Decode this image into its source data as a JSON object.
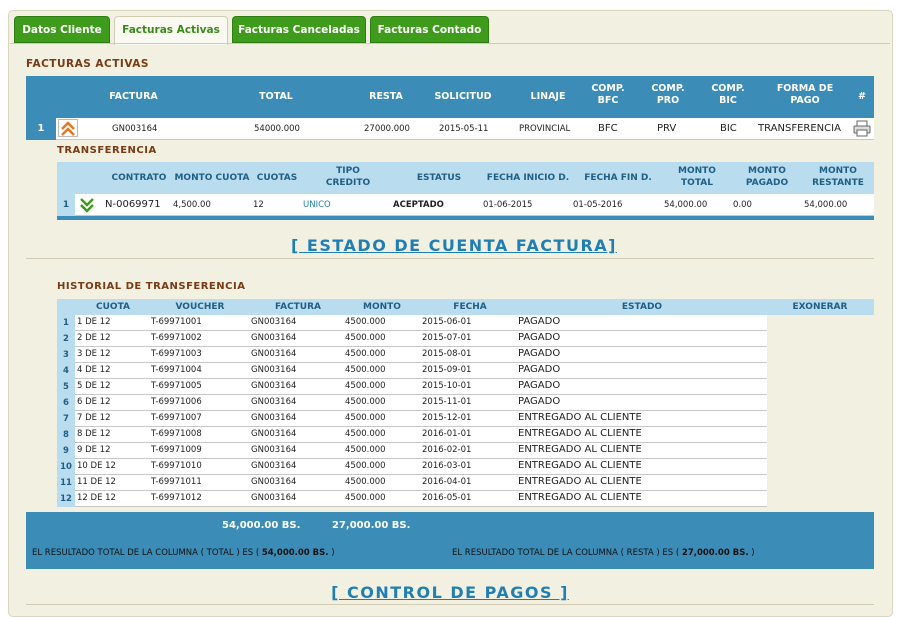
{
  "tabs": [
    {
      "label": "Datos Cliente",
      "active": false
    },
    {
      "label": "Facturas Activas",
      "active": true
    },
    {
      "label": "Facturas Canceladas",
      "active": false
    },
    {
      "label": "Facturas Contado",
      "active": false
    }
  ],
  "facturas": {
    "title": "FACTURAS ACTIVAS",
    "headers": {
      "factura": "FACTURA",
      "total": "TOTAL",
      "resta": "RESTA",
      "solicitud": "SOLICITUD",
      "linaje": "LINAJE",
      "comp_bfc": "COMP. BFC",
      "comp_pro": "COMP. PRO",
      "comp_bic": "COMP. BIC",
      "forma_pago": "FORMA DE PAGO",
      "hash": "#"
    },
    "row": {
      "index": "1",
      "factura": "GN003164",
      "total": "54000.000",
      "resta": "27000.000",
      "solicitud": "2015-05-11",
      "linaje": "PROVINCIAL",
      "comp_bfc": "BFC",
      "comp_pro": "PRV",
      "comp_bic": "BIC",
      "forma_pago": "TRANSFERENCIA",
      "collapse_icon": "double-chevron-up-icon",
      "print_icon": "printer-icon"
    }
  },
  "transferencia": {
    "title": "TRANSFERENCIA",
    "headers": {
      "contrato": "CONTRATO",
      "monto_cuota": "MONTO CUOTA",
      "cuotas": "CUOTAS",
      "tipo_credito": "TIPO CREDITO",
      "estatus": "ESTATUS",
      "fecha_inicio": "FECHA INICIO D.",
      "fecha_fin": "FECHA FIN D.",
      "monto_total": "MONTO TOTAL",
      "monto_pagado": "MONTO PAGADO",
      "monto_restante": "MONTO RESTANTE"
    },
    "row": {
      "index": "1",
      "contrato": "N-0069971",
      "monto_cuota": "4,500.00",
      "cuotas": "12",
      "tipo_credito": "UNICO",
      "estatus": "ACEPTADO",
      "fecha_inicio": "01-06-2015",
      "fecha_fin": "01-05-2016",
      "monto_total": "54,000.00",
      "monto_pagado": "0.00",
      "monto_restante": "54,000.00",
      "expand_icon": "double-chevron-down-icon"
    }
  },
  "estado_link": "[ ESTADO DE CUENTA FACTURA]",
  "historial": {
    "title": "HISTORIAL DE TRANSFERENCIA",
    "headers": {
      "cuota": "CUOTA",
      "voucher": "VOUCHER",
      "factura": "FACTURA",
      "monto": "MONTO",
      "fecha": "FECHA",
      "estado": "ESTADO",
      "exonerar": "EXONERAR"
    },
    "rows": [
      {
        "i": "1",
        "cuota": "1 DE 12",
        "voucher": "T-69971001",
        "factura": "GN003164",
        "monto": "4500.000",
        "fecha": "2015-06-01",
        "estado": "PAGADO"
      },
      {
        "i": "2",
        "cuota": "2 DE 12",
        "voucher": "T-69971002",
        "factura": "GN003164",
        "monto": "4500.000",
        "fecha": "2015-07-01",
        "estado": "PAGADO"
      },
      {
        "i": "3",
        "cuota": "3 DE 12",
        "voucher": "T-69971003",
        "factura": "GN003164",
        "monto": "4500.000",
        "fecha": "2015-08-01",
        "estado": "PAGADO"
      },
      {
        "i": "4",
        "cuota": "4 DE 12",
        "voucher": "T-69971004",
        "factura": "GN003164",
        "monto": "4500.000",
        "fecha": "2015-09-01",
        "estado": "PAGADO"
      },
      {
        "i": "5",
        "cuota": "5 DE 12",
        "voucher": "T-69971005",
        "factura": "GN003164",
        "monto": "4500.000",
        "fecha": "2015-10-01",
        "estado": "PAGADO"
      },
      {
        "i": "6",
        "cuota": "6 DE 12",
        "voucher": "T-69971006",
        "factura": "GN003164",
        "monto": "4500.000",
        "fecha": "2015-11-01",
        "estado": "PAGADO"
      },
      {
        "i": "7",
        "cuota": "7 DE 12",
        "voucher": "T-69971007",
        "factura": "GN003164",
        "monto": "4500.000",
        "fecha": "2015-12-01",
        "estado": "ENTREGADO AL CLIENTE"
      },
      {
        "i": "8",
        "cuota": "8 DE 12",
        "voucher": "T-69971008",
        "factura": "GN003164",
        "monto": "4500.000",
        "fecha": "2016-01-01",
        "estado": "ENTREGADO AL CLIENTE"
      },
      {
        "i": "9",
        "cuota": "9 DE 12",
        "voucher": "T-69971009",
        "factura": "GN003164",
        "monto": "4500.000",
        "fecha": "2016-02-01",
        "estado": "ENTREGADO AL CLIENTE"
      },
      {
        "i": "10",
        "cuota": "10 DE 12",
        "voucher": "T-69971010",
        "factura": "GN003164",
        "monto": "4500.000",
        "fecha": "2016-03-01",
        "estado": "ENTREGADO AL CLIENTE"
      },
      {
        "i": "11",
        "cuota": "11 DE 12",
        "voucher": "T-69971011",
        "factura": "GN003164",
        "monto": "4500.000",
        "fecha": "2016-04-01",
        "estado": "ENTREGADO AL CLIENTE"
      },
      {
        "i": "12",
        "cuota": "12 DE 12",
        "voucher": "T-69971012",
        "factura": "GN003164",
        "monto": "4500.000",
        "fecha": "2016-05-01",
        "estado": "ENTREGADO AL CLIENTE"
      }
    ],
    "totals": {
      "sum_total": "54,000.00 BS.",
      "sum_resta": "27,000.00 BS.",
      "result_total_prefix": "EL RESULTADO TOTAL DE LA COLUMNA ( TOTAL ) ES (",
      "result_total_value": "54,000.00 BS.",
      "result_resta_prefix": "EL RESULTADO TOTAL DE LA COLUMNA ( RESTA ) ES (",
      "result_resta_value": "27,000.00 BS.",
      "close_paren": ")"
    }
  },
  "control_link": "[ CONTROL DE PAGOS ]"
}
